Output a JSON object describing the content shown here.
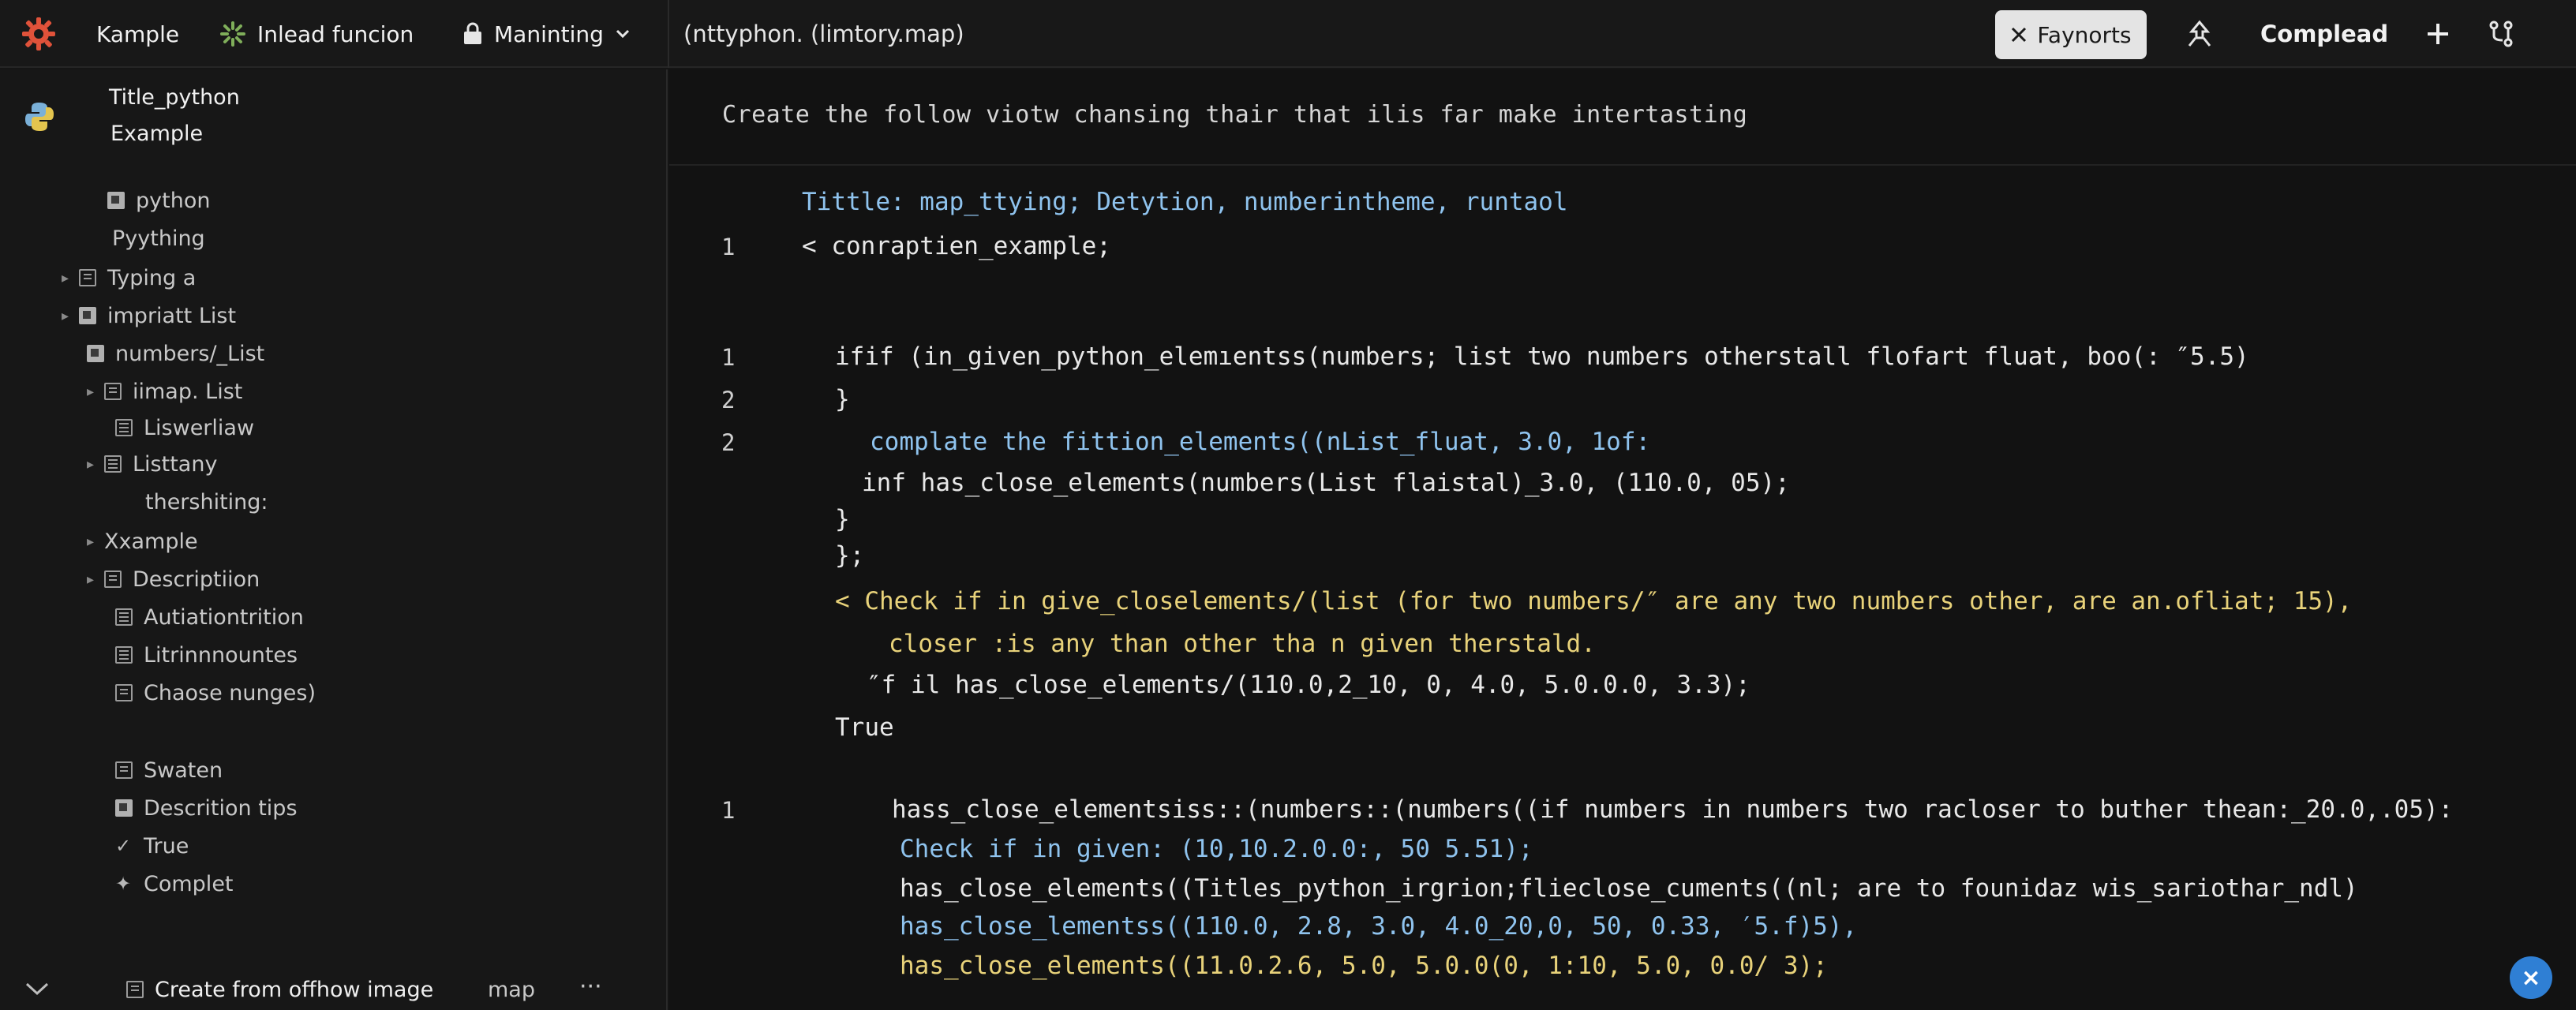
{
  "topbar": {
    "app_name": "Kample",
    "function_label": "Inlead funcion",
    "maintaining_label": "Maninting",
    "path": "(nttyphon. (limtory.map)",
    "faynorts_label": "Faynorts",
    "compleaad_label": "Complead"
  },
  "sidebar": {
    "title": "Title_python",
    "subtitle": "Example",
    "items": [
      {
        "label": "python"
      },
      {
        "label": "Pyything"
      },
      {
        "label": "Typing a"
      },
      {
        "label": "impriatt List"
      },
      {
        "label": "numbers/_List"
      },
      {
        "label": "iimap. List"
      },
      {
        "label": "Liswerliaw"
      },
      {
        "label": "Listtany"
      },
      {
        "label": "thershiting:"
      },
      {
        "label": "Xxample"
      },
      {
        "label": "Descriptiion"
      },
      {
        "label": "Autiationtrition"
      },
      {
        "label": "Litrinnnountes"
      },
      {
        "label": "Chaose nunges)"
      },
      {
        "label": "Swaten"
      },
      {
        "label": "Descrition tips"
      },
      {
        "label": "True"
      },
      {
        "label": "Complet"
      }
    ],
    "bottom": {
      "create_label": "Create from offhow image",
      "map_label": "map",
      "more_label": "···"
    }
  },
  "editor": {
    "prompt": "Create the follow viotw chansing thair that ilis far make intertasting",
    "lines": [
      {
        "num": "",
        "text": "Tittle: map_ttying; Detytion, numberintheme, runtaol"
      },
      {
        "num": "1",
        "text": "< conraptien_example;"
      },
      {
        "num": "1",
        "text": "ifif (in_given_python_elemıentss(numbers; list two numbers otherstall flofart fluat, boo(: ″5.5)"
      },
      {
        "num": "2",
        "text": "}"
      },
      {
        "num": "2",
        "text": "complate the fittion_elements((nList_fluat, 3.0, 1of:"
      },
      {
        "num": "",
        "text": "inf has_close_elements(numbers(List flaistal)_3.0, (110.0, 05);"
      },
      {
        "num": "",
        "text": "}"
      },
      {
        "num": "",
        "text": "};"
      },
      {
        "num": "",
        "text": "< Check if in give_closelements/(list (for two numbers/″ are any two numbers other, are an.ofliat; 15),"
      },
      {
        "num": "",
        "text": "closer :is any than other tha n given therstald."
      },
      {
        "num": "",
        "text": "″f il has_close_elements/(110.0,2_10, 0, 4.0, 5.0.0.0, 3.3);"
      },
      {
        "num": "",
        "text": "True"
      },
      {
        "num": "1",
        "text": "hass_close_elementsiss::(numbers::(numbers((if numbers in numbers two racloser to buther thean:_20.0,.05):"
      },
      {
        "num": "",
        "text": "Check if  in given: (10,10.2.0.0:, 50 5.51);"
      },
      {
        "num": "",
        "text": "has_close_elements((Titles_python_irgrion;flieclose_cuments((nl; are to founidaz wis_sariothar_ndl)"
      },
      {
        "num": "",
        "text": "has_close_lementss((110.0, 2.8, 3.0, 4.0_20,0, 50, 0.33, ′5.f)5),"
      },
      {
        "num": "",
        "text": "has_close_elements((11.0.2.6, 5.0, 5.0.0(0, 1:10, 5.0, 0.0/ 3);"
      }
    ]
  },
  "fab_label": "×",
  "colors": {
    "accent_blue": "#2f7fd4",
    "code_blue": "#8fc3ee",
    "code_yellow": "#e8d27a",
    "logo_red": "#e0523a"
  },
  "icons": [
    "gear-logo-icon",
    "spinner-icon",
    "lock-icon",
    "chevron-down-icon",
    "close-icon",
    "pin-icon",
    "plus-icon",
    "branch-icon",
    "python-icon",
    "document-icon"
  ]
}
